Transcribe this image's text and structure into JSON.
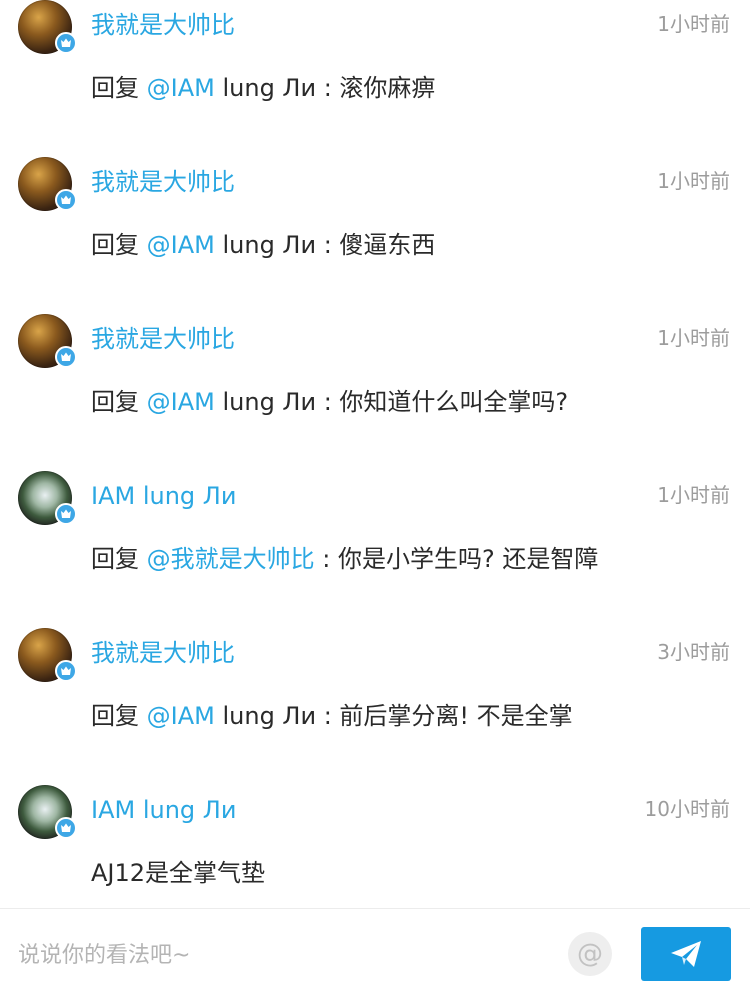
{
  "comments": [
    {
      "username": "我就是大帅比",
      "time": "1小时前",
      "reply_prefix": "回复 ",
      "mention": "@IAM",
      "text": " lung Ли : 滚你麻痹",
      "avatar": "basketball-player-avatar"
    },
    {
      "username": "我就是大帅比",
      "time": "1小时前",
      "reply_prefix": "回复 ",
      "mention": "@IAM",
      "text": " lung Ли : 傻逼东西",
      "avatar": "basketball-player-avatar"
    },
    {
      "username": "我就是大帅比",
      "time": "1小时前",
      "reply_prefix": "回复 ",
      "mention": "@IAM",
      "text": " lung Ли : 你知道什么叫全掌吗?",
      "avatar": "basketball-player-avatar"
    },
    {
      "username": "IAM lung Ли",
      "time": "1小时前",
      "reply_prefix": "回复 ",
      "mention": "@我就是大帅比",
      "text": " : 你是小学生吗? 还是智障",
      "avatar": "outdoor-court-avatar"
    },
    {
      "username": "我就是大帅比",
      "time": "3小时前",
      "reply_prefix": "回复 ",
      "mention": "@IAM",
      "text": " lung Ли : 前后掌分离! 不是全掌",
      "avatar": "basketball-player-avatar"
    },
    {
      "username": "IAM lung Ли",
      "time": "10小时前",
      "reply_prefix": "",
      "mention": "",
      "text": "AJ12是全掌气垫",
      "avatar": "outdoor-court-avatar"
    }
  ],
  "input_bar": {
    "placeholder": "说说你的看法吧~",
    "at_symbol": "@",
    "send_icon": "paper-plane-icon"
  },
  "colors": {
    "accent": "#2aa7e2",
    "send_button": "#169ae1",
    "badge": "#3ea7e6",
    "time": "#9c9c9c"
  }
}
